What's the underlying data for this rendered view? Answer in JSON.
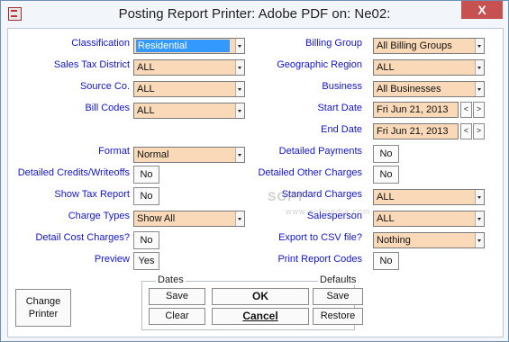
{
  "window": {
    "title": "Posting Report  Printer: Adobe PDF on: Ne02:",
    "close_label": "X"
  },
  "left": {
    "classification": {
      "label": "Classification",
      "value": "Residential"
    },
    "sales_tax_district": {
      "label": "Sales Tax District",
      "value": "ALL"
    },
    "source_co": {
      "label": "Source Co.",
      "value": "ALL"
    },
    "bill_codes": {
      "label": "Bill Codes",
      "value": "ALL"
    },
    "format": {
      "label": "Format",
      "value": "Normal"
    },
    "detailed_credits": {
      "label": "Detailed Credits/Writeoffs",
      "value": "No"
    },
    "show_tax_report": {
      "label": "Show Tax Report",
      "value": "No"
    },
    "charge_types": {
      "label": "Charge Types",
      "value": "Show All"
    },
    "detail_cost_charges": {
      "label": "Detail Cost Charges?",
      "value": "No"
    },
    "preview": {
      "label": "Preview",
      "value": "Yes"
    }
  },
  "right": {
    "billing_group": {
      "label": "Billing Group",
      "value": "All Billing Groups"
    },
    "geographic_region": {
      "label": "Geographic Region",
      "value": "ALL"
    },
    "business": {
      "label": "Business",
      "value": "All Businesses"
    },
    "start_date": {
      "label": "Start Date",
      "value": "Fri Jun 21, 2013"
    },
    "end_date": {
      "label": "End Date",
      "value": "Fri Jun 21, 2013"
    },
    "detailed_payments": {
      "label": "Detailed Payments",
      "value": "No"
    },
    "detailed_other_charges": {
      "label": "Detailed Other Charges",
      "value": "No"
    },
    "standard_charges": {
      "label": "Standard Charges",
      "value": "ALL"
    },
    "salesperson": {
      "label": "Salesperson",
      "value": "ALL"
    },
    "export_csv": {
      "label": "Export to CSV file?",
      "value": "Nothing"
    },
    "print_report_codes": {
      "label": "Print Report Codes",
      "value": "No"
    }
  },
  "spin": {
    "prev": "<",
    "next": ">"
  },
  "buttons": {
    "change_printer": "Change Printer",
    "dates_title": "Dates",
    "dates_save": "Save",
    "dates_clear": "Clear",
    "ok": "OK",
    "cancel": "Cancel",
    "defaults_title": "Defaults",
    "defaults_save": "Save",
    "defaults_restore": "Restore"
  },
  "watermark": {
    "text": "SOFT",
    "sub": "www.softpedia.com"
  }
}
